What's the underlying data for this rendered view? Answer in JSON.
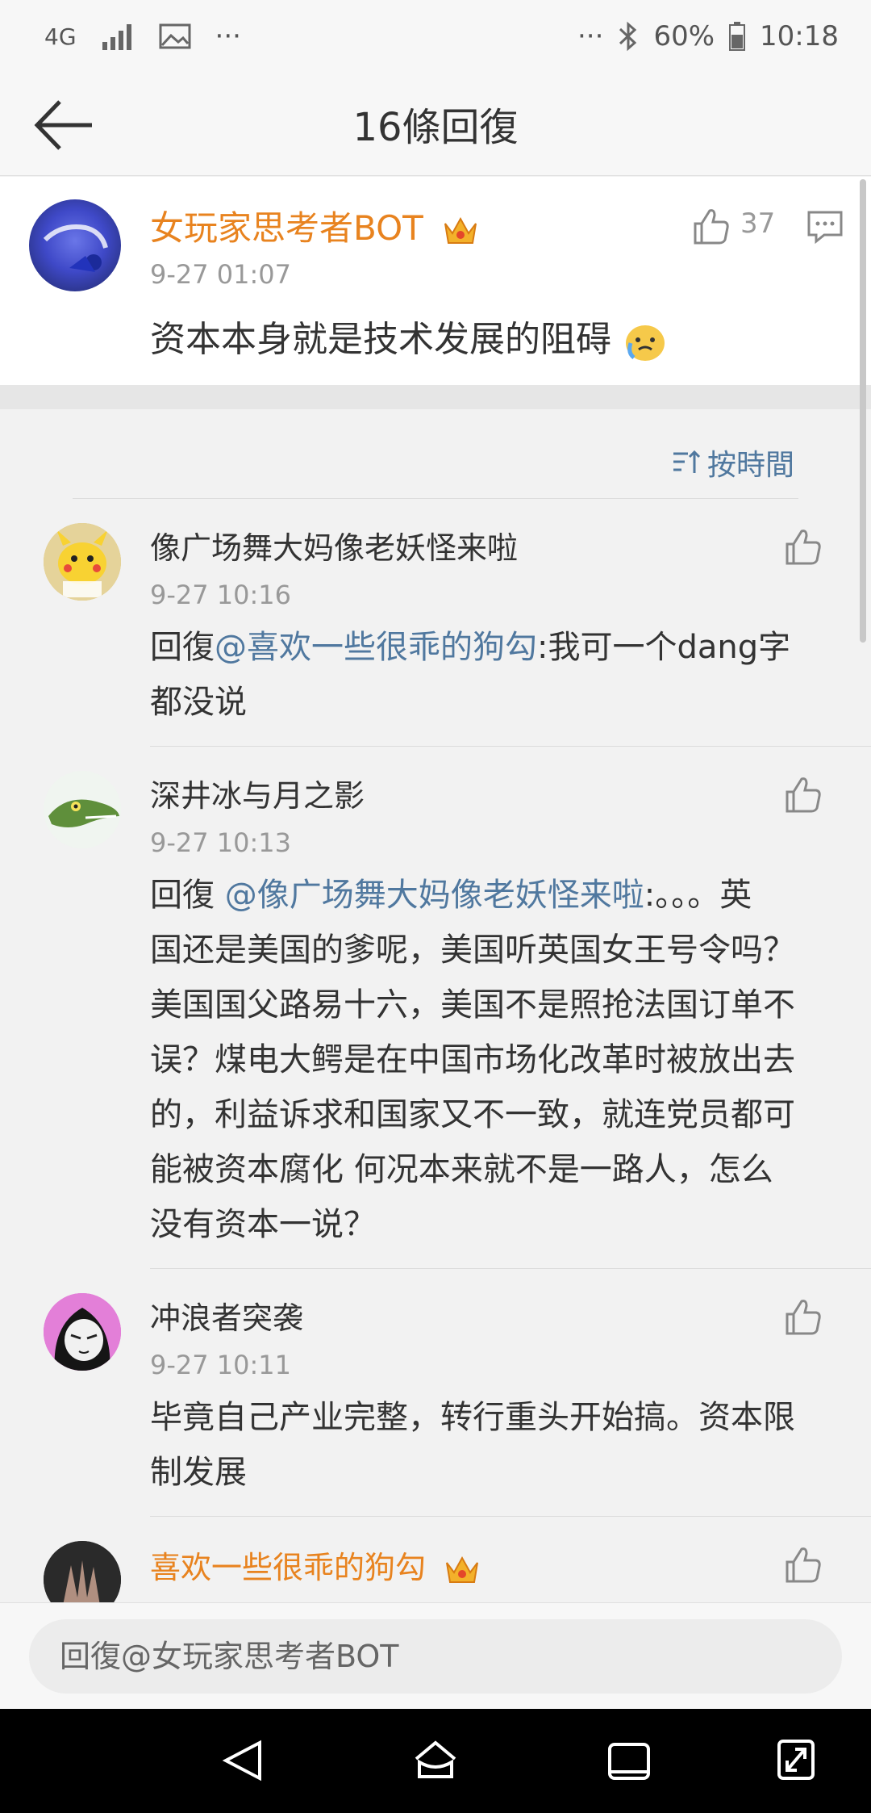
{
  "status_bar": {
    "network": "4G",
    "battery": "60%",
    "time": "10:18",
    "icons": [
      "signal-icon",
      "image-icon",
      "more-dots-icon",
      "bluetooth-icon",
      "battery-icon"
    ]
  },
  "header": {
    "title": "16條回復"
  },
  "main_comment": {
    "user": "女玩家思考者BOT",
    "time": "9-27 01:07",
    "text": "资本本身就是技术发展的阻碍",
    "likes": "37"
  },
  "sort": {
    "label": "按時間"
  },
  "replies": [
    {
      "user": "像广场舞大妈像老妖怪来啦",
      "time": "9-27 10:16",
      "prefix": "回復",
      "mention": "@喜欢一些很乖的狗勾",
      "text_line1": ":我可一个dang字",
      "text_line2": "都没说"
    },
    {
      "user": "深井冰与月之影",
      "time": "9-27 10:13",
      "prefix": "回復 ",
      "mention": "@像广场舞大妈像老妖怪来啦",
      "text_line1": ":。。。英",
      "lines": [
        "国还是美国的爹呢，美国听英国女王号令吗？",
        "美国国父路易十六，美国不是照抢法国订单不",
        "误？煤电大鳄是在中国市场化改革时被放出去",
        "的，利益诉求和国家又不一致，就连党员都可",
        "能被资本腐化 何况本来就不是一路人，怎么",
        "没有资本一说？"
      ]
    },
    {
      "user": "冲浪者突袭",
      "time": "9-27 10:11",
      "lines": [
        "毕竟自己产业完整，转行重头开始搞。资本限",
        "制发展"
      ]
    },
    {
      "user": "喜欢一些很乖的狗勾"
    }
  ],
  "reply_bar": {
    "placeholder": "回復@女玩家思考者BOT"
  },
  "colors": {
    "accent_blue": "#50789f",
    "orange_name": "#e8831f"
  }
}
